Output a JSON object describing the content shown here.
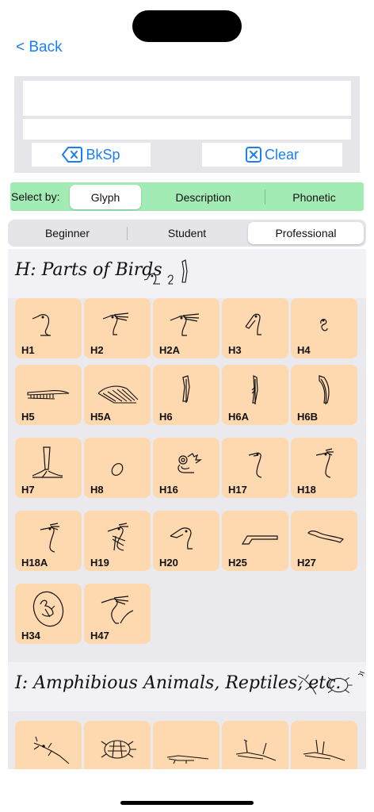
{
  "nav": {
    "back_label": "< Back"
  },
  "controls": {
    "backspace_label": "BkSp",
    "clear_label": "Clear"
  },
  "select_by": {
    "label": "Select by:",
    "options": [
      "Glyph",
      "Description",
      "Phonetic"
    ],
    "selected": "Glyph"
  },
  "levels": {
    "options": [
      "Beginner",
      "Student",
      "Professional"
    ],
    "selected": "Professional"
  },
  "sections": [
    {
      "title": "H: Parts of Birds",
      "tiles": [
        {
          "code": "H1",
          "icon": "duck-head-glyph"
        },
        {
          "code": "H2",
          "icon": "crested-bird-head-glyph"
        },
        {
          "code": "H2A",
          "icon": "crested-bird-head-variant-glyph"
        },
        {
          "code": "H3",
          "icon": "spoonbill-head-glyph"
        },
        {
          "code": "H4",
          "icon": "vulture-head-glyph"
        },
        {
          "code": "H5",
          "icon": "wing-glyph"
        },
        {
          "code": "H5A",
          "icon": "spread-wing-glyph"
        },
        {
          "code": "H6",
          "icon": "feather-glyph"
        },
        {
          "code": "H6A",
          "icon": "feather-variant-glyph"
        },
        {
          "code": "H6B",
          "icon": "curled-feather-glyph"
        },
        {
          "code": "H7",
          "icon": "bird-claw-glyph"
        },
        {
          "code": "H8",
          "icon": "egg-glyph"
        },
        {
          "code": "H16",
          "icon": "ornament-glyph"
        },
        {
          "code": "H17",
          "icon": "long-neck-bird-glyph"
        },
        {
          "code": "H18",
          "icon": "crested-neck-glyph"
        },
        {
          "code": "H18A",
          "icon": "crested-neck-variant-glyph"
        },
        {
          "code": "H19",
          "icon": "bird-neck-scarf-glyph"
        },
        {
          "code": "H20",
          "icon": "pelican-head-glyph"
        },
        {
          "code": "H25",
          "icon": "foot-shape-glyph"
        },
        {
          "code": "H27",
          "icon": "curved-beak-glyph"
        },
        {
          "code": "H34",
          "icon": "egg-with-bird-glyph"
        },
        {
          "code": "H47",
          "icon": "bird-head-arch-glyph"
        }
      ]
    },
    {
      "title": "I: Amphibious Animals, Reptiles, etc.",
      "tiles": [
        {
          "code": "",
          "icon": "lizard-glyph"
        },
        {
          "code": "",
          "icon": "turtle-glyph"
        },
        {
          "code": "",
          "icon": "crocodile-glyph"
        },
        {
          "code": "",
          "icon": "crocodile-with-feathers-glyph"
        },
        {
          "code": "",
          "icon": "crocodile-with-pole-glyph"
        }
      ]
    }
  ],
  "colors": {
    "accent": "#1a7ef5",
    "tile": "#fed8ae",
    "select_bar": "#a3ebb4",
    "section_bg": "#e9e9ee"
  }
}
